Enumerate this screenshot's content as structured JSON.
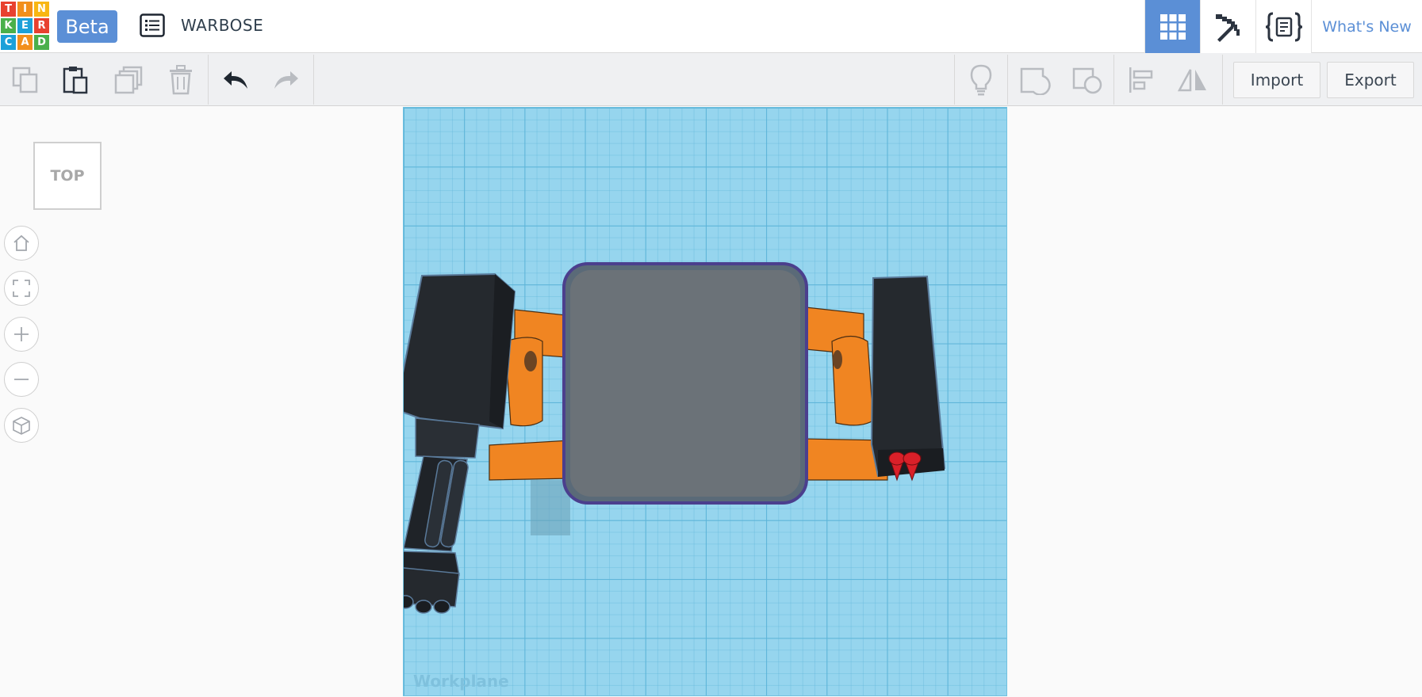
{
  "app": {
    "logo_letters": [
      "T",
      "I",
      "N",
      "K",
      "E",
      "R",
      "C",
      "A",
      "D"
    ],
    "logo_colors": [
      "#e8412f",
      "#f28f1c",
      "#f8b614",
      "#4ab04b",
      "#1ca0d9",
      "#e8412f",
      "#1ca0d9",
      "#f28f1c",
      "#4ab04b"
    ],
    "beta_label": "Beta",
    "project_title": "WARBOSE"
  },
  "header": {
    "buttons": [
      {
        "name": "3d-design-view",
        "icon": "grid-icon",
        "active": true
      },
      {
        "name": "blocks-view",
        "icon": "pickaxe-icon",
        "active": false
      },
      {
        "name": "codeblocks-view",
        "icon": "codeblocks-icon",
        "active": false
      }
    ],
    "whats_new_label": "What's New"
  },
  "toolbar": {
    "copy_icon": "copy-icon",
    "paste_icon": "paste-icon",
    "duplicate_icon": "duplicate-icon",
    "delete_icon": "trash-icon",
    "undo_icon": "undo-icon",
    "redo_icon": "redo-icon",
    "hint_icon": "lightbulb-icon",
    "group_icon": "group-icon",
    "ungroup_icon": "ungroup-icon",
    "align_icon": "align-icon",
    "mirror_icon": "mirror-icon",
    "import_label": "Import",
    "export_label": "Export"
  },
  "viewport": {
    "viewcube_label": "TOP",
    "nav": [
      "home-icon",
      "fit-view-icon",
      "zoom-in-icon",
      "zoom-out-icon",
      "orthographic-cube-icon"
    ],
    "workplane_label": "Workplane"
  },
  "colors": {
    "accent": "#5b8fd6",
    "workplane": "#96d5ee",
    "model_orange": "#f08522",
    "model_dark": "#25292e",
    "model_gray": "#6b7278",
    "model_red": "#d92029"
  }
}
